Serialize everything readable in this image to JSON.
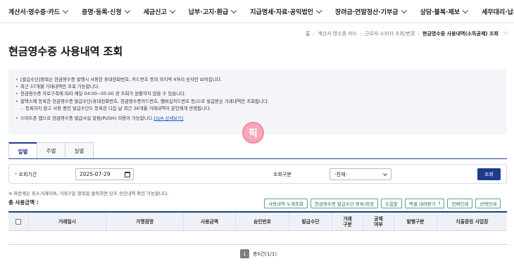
{
  "nav": {
    "items": [
      {
        "label": "계산서·영수증·카드"
      },
      {
        "label": "증명·등록·신청"
      },
      {
        "label": "세금신고"
      },
      {
        "label": "납부·고지·환급"
      },
      {
        "label": "지급명세·자료·공익법인"
      },
      {
        "label": "장려금·연말정산·기부금"
      },
      {
        "label": "상담·불복·제보"
      },
      {
        "label": "세무대리·납세관리"
      }
    ]
  },
  "breadcrumb": {
    "home": "홈",
    "items": [
      "계산서·영수증·카드",
      "근로자·소비자 조회/변경"
    ],
    "current": "현금영수증 사용내역(소득공제) 조회",
    "sep": "›"
  },
  "page_title": "현금영수증 사용내역 조회",
  "notice": {
    "lines": [
      "[발급수단]항목은 현금영수증 발행시 사용한 휴대전화번호, 카드번호 등의 마지막 4자리 숫자만 보여집니다.",
      "최근 37개월 거래내역만 조회 가능합니다.",
      "현금영수증 자료구축에 따라 매일 04:00~05:00 경 조회가 원활하지 않을 수 있습니다.",
      "홈택스에 등록한 현금영수증 발급수단(휴대전화번호, 현금영수증카드번호, 멤버십카드번호 등)으로 발급받은 거래내역만 조회됩니다.",
      "등록하지 않고 사용 중인 발급수단도 등록한 다음 날 최근 36개월 거래내역이 본인에게 반영됩니다.",
      "스마트폰 앱으로 현금영수증 발급사실 알림(PUSH) 이용이 가능합니다."
    ],
    "link": "[Q/A 상세보기]"
  },
  "mascot_text": "픽",
  "tabs": [
    "일별",
    "주별",
    "월별"
  ],
  "search": {
    "period_label": "조회기간",
    "date_value": "2025-07-29",
    "type_label": "조회구분",
    "type_value": "-전체-",
    "submit": "조회"
  },
  "hint": "※ 파란색은 취소거래이며, 거래구분 항목을 클릭하면 당초 승인내역 확인 가능합니다.",
  "total_label": "총 사용금액 :",
  "actions": {
    "monthly_total": "사용내역 누계조회",
    "register": "현금영수증 발급수단 등록/정정",
    "help": "도움말",
    "excel": "엑셀 내려받기",
    "print_all": "전체인쇄",
    "print_selected": "선택인쇄"
  },
  "table": {
    "headers": [
      "거래일시",
      "가맹점명",
      "사용금액",
      "승인번호",
      "발급수단",
      "거래\n구분",
      "공제\n여부",
      "발행구분",
      "지출증빙 사업장"
    ]
  },
  "pager": {
    "page": "1",
    "info": "총0건(1/1)"
  },
  "colors": {
    "primary": "#1e3c8c",
    "action_border": "#5f9f8a",
    "notice_bg": "#f3f5f9"
  }
}
